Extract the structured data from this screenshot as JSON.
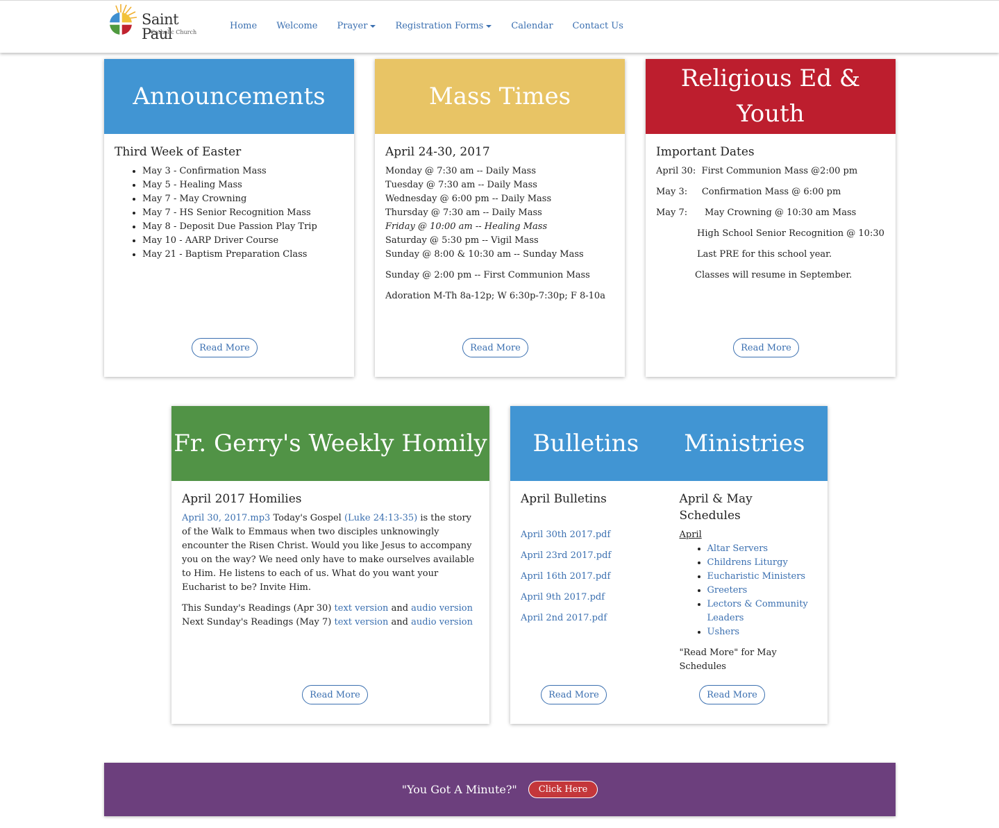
{
  "brand": {
    "name": "Saint Paul",
    "sub": "Catholic Church"
  },
  "nav": [
    {
      "label": "Home"
    },
    {
      "label": "Welcome"
    },
    {
      "label": "Prayer"
    },
    {
      "label": "Registration Forms"
    },
    {
      "label": "Calendar"
    },
    {
      "label": "Contact Us"
    }
  ],
  "announcements": {
    "title": "Announcements",
    "subtitle": "Third Week of Easter",
    "items": [
      "May 3 - Confirmation Mass",
      "May 5 - Healing Mass",
      "May 7 - May Crowning",
      "May 7 - HS Senior Recognition Mass",
      "May 8 -  Deposit Due Passion Play Trip",
      "May 10 - AARP Driver Course",
      "May 21 - Baptism Preparation Class"
    ],
    "read_more": "Read More"
  },
  "mass": {
    "title": "Mass Times",
    "subtitle": "April 24-30, 2017",
    "lines": [
      "Monday @ 7:30 am -- Daily Mass",
      "Tuesday @ 7:30 am  -- Daily Mass",
      "Wednesday @ 6:00 pm -- Daily Mass",
      "Thursday @ 7:30 am -- Daily Mass",
      "Friday @ 10:00 am -- Healing Mass",
      "Saturday @ 5:30 pm -- Vigil Mass",
      "Sunday  @ 8:00 & 10:30 am -- Sunday Mass"
    ],
    "extra1": "Sunday @ 2:00 pm -- First Communion Mass",
    "extra2": "Adoration M-Th 8a-12p; W 6:30p-7:30p; F 8-10a",
    "read_more": "Read More"
  },
  "religious": {
    "title": "Religious Ed & Youth",
    "subtitle": "Important Dates",
    "l1": "April 30:  First Communion Mass @2:00 pm",
    "l2": "May 3:     Confirmation Mass @ 6:00 pm",
    "l3": "May 7:      May Crowning @ 10:30 am Mass",
    "l4": "High School Senior Recognition @ 10:30",
    "l5": "Last PRE for this school year.",
    "l6": "Classes will resume in September.",
    "read_more": "Read More"
  },
  "homily": {
    "title": "Fr. Gerry's Weekly Homily",
    "subtitle": "April 2017 Homilies",
    "link1": "April 30, 2017.mp3",
    "text1": "  Today's Gospel ",
    "link2": "(Luke 24:13-35)",
    "text2": " is the story of the Walk to Emmaus when two disciples unknowingly encounter the Risen Christ. Would you like Jesus to accompany you on the way? We need only have to make ourselves available to Him. He listens to each of us. What do you want your Eucharist to be? Invite Him.",
    "r1_pre": "This Sunday's Readings (Apr 30) ",
    "r2_pre": "Next Sunday's Readings (May 7) ",
    "text_version": "text version",
    "and": " and ",
    "audio_version": "audio version",
    "read_more": "Read More"
  },
  "bulletins": {
    "title": "Bulletins",
    "subtitle": "April Bulletins",
    "files": [
      "April 30th 2017.pdf",
      "April 23rd 2017.pdf",
      "April 16th 2017.pdf",
      "April 9th 2017.pdf",
      "April 2nd 2017.pdf"
    ],
    "read_more": "Read More"
  },
  "ministries": {
    "title": "Ministries",
    "subtitle": "April & May Schedules",
    "month": "April",
    "items": [
      "Altar Servers",
      "Childrens Liturgy",
      "Eucharistic Ministers",
      "Greeters",
      "Lectors & Community Leaders",
      "Ushers"
    ],
    "note": "\"Read More\" for May Schedules",
    "read_more": "Read More"
  },
  "banner": {
    "text": "\"You Got A Minute?\"",
    "button": "Click Here"
  },
  "colors": {
    "blue": "#4195d3",
    "yellow": "#e8c465",
    "red": "#bd1e2e",
    "green": "#519346",
    "purple": "#6c3f7d",
    "link": "#3a6fb0"
  }
}
